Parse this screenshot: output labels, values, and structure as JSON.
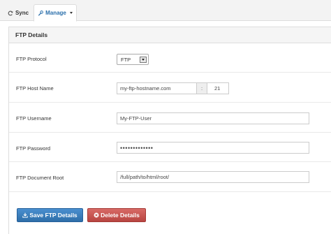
{
  "tabs": [
    {
      "label": "Sync",
      "icon": "refresh-icon"
    },
    {
      "label": "Manage",
      "icon": "wrench-icon",
      "active": true
    }
  ],
  "panel": {
    "title": "FTP Details"
  },
  "fields": {
    "protocol": {
      "label": "FTP Protocol",
      "value": "FTP"
    },
    "host": {
      "label": "FTP Host Name",
      "value": "my-ftp-hostname.com",
      "separator": ":",
      "port": "21"
    },
    "username": {
      "label": "FTP Username",
      "value": "My-FTP-User"
    },
    "password": {
      "label": "FTP Password",
      "value": "•••••••••••••"
    },
    "docroot": {
      "label": "FTP Document Root",
      "value": "/full/path/to/html/root/"
    }
  },
  "buttons": {
    "save": {
      "label": "Save FTP Details",
      "icon": "save-icon",
      "color": "#3a7fc1"
    },
    "delete": {
      "label": "Delete Details",
      "icon": "delete-icon",
      "color": "#c9524e"
    }
  }
}
